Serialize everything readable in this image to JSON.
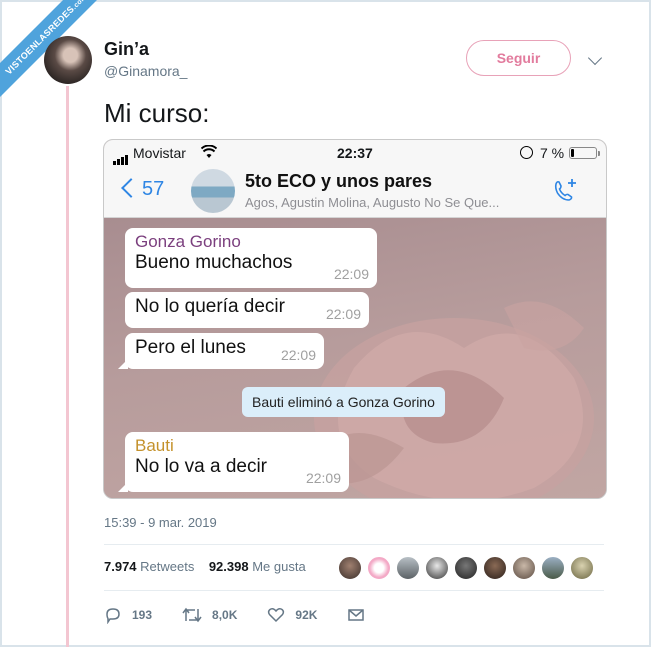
{
  "watermark": {
    "line1": "VISTOENLASREDES",
    "line2": ".com"
  },
  "tweet": {
    "author_name": "Gin’a",
    "author_handle": "@Ginamora_",
    "follow_label": "Seguir",
    "text": "Mi curso:",
    "datetime": "15:39 - 9 mar. 2019",
    "retweets_count": "7.974",
    "retweets_label": "Retweets",
    "likes_count": "92.398",
    "likes_label": "Me gusta",
    "actions": {
      "replies": "193",
      "retweets": "8,0K",
      "likes": "92K"
    }
  },
  "phone": {
    "carrier": "Movistar",
    "time": "22:37",
    "battery": "7 %",
    "back_count": "57",
    "group_title": "5to ECO y unos pares",
    "group_members": "Agos, Agustin Molina, Augusto No Se Que...",
    "messages": [
      {
        "sender": "Gonza Gorino",
        "sender_color": "#7b3f7e",
        "text": "Bueno muchachos",
        "time": "22:09"
      },
      {
        "text": "No lo quería decir",
        "time": "22:09"
      },
      {
        "text": "Pero el lunes",
        "time": "22:09"
      },
      {
        "system": "Bauti eliminó a Gonza Gorino"
      },
      {
        "sender": "Bauti",
        "sender_color": "#c4922c",
        "text": "No lo va a decir",
        "time": "22:09"
      }
    ]
  },
  "colors": {
    "accent_pink": "#e27b9d",
    "ios_blue": "#2f86e4",
    "twitter_gray": "#657786"
  },
  "icons": [
    "reply-icon",
    "retweet-icon",
    "heart-icon",
    "mail-icon",
    "wifi-icon",
    "alarm-icon",
    "battery-icon",
    "call-add-icon"
  ]
}
